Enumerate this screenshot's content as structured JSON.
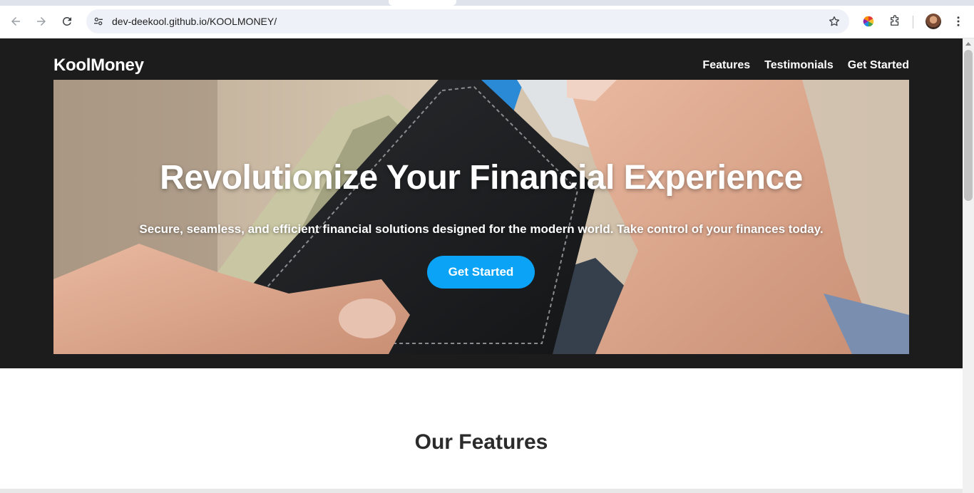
{
  "browser": {
    "url": "dev-deekool.github.io/KOOLMONEY/",
    "icons": [
      "back-icon",
      "forward-icon",
      "reload-icon",
      "site-info-icon",
      "bookmark-star-icon",
      "color-extension-icon",
      "extensions-puzzle-icon",
      "profile-avatar",
      "more-menu-icon"
    ]
  },
  "site": {
    "brand": "KoolMoney",
    "nav": [
      {
        "label": "Features"
      },
      {
        "label": "Testimonials"
      },
      {
        "label": "Get Started"
      }
    ]
  },
  "hero": {
    "title": "Revolutionize Your Financial Experience",
    "subtitle": "Secure, seamless, and efficient financial solutions designed for the modern world. Take control of your finances today.",
    "cta_label": "Get Started"
  },
  "features": {
    "heading": "Our Features"
  },
  "colors": {
    "header_bg": "#1c1c1c",
    "accent": "#0aa3f5",
    "text_dark": "#2b2b2b"
  }
}
